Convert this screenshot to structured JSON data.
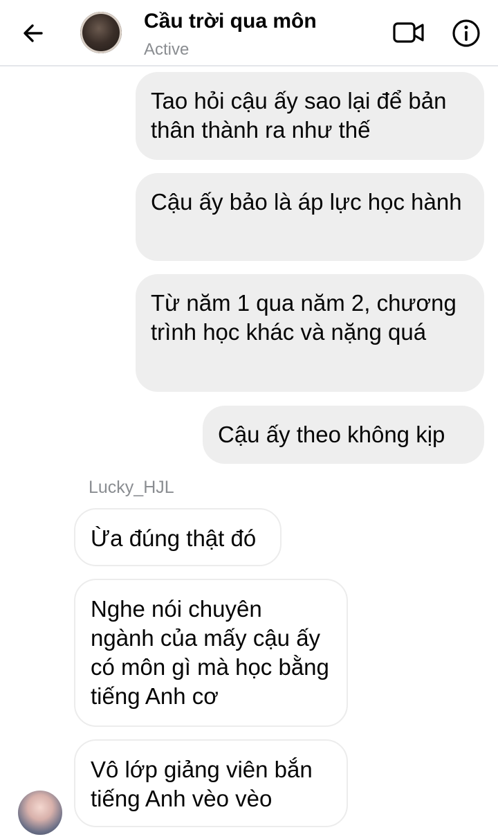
{
  "header": {
    "back_icon": "arrow-left-icon",
    "title": "Cầu trời qua môn",
    "status": "Active",
    "video_icon": "video-camera-icon",
    "info_icon": "info-icon"
  },
  "messages": [
    {
      "direction": "sent",
      "text": "Tao hỏi cậu ấy sao lại để bản thân thành ra như thế"
    },
    {
      "direction": "sent",
      "text": "Cậu ấy bảo là áp lực học hành"
    },
    {
      "direction": "sent",
      "text": "Từ năm 1 qua năm 2, chương trình học khác và nặng quá"
    },
    {
      "direction": "sent",
      "text": "Cậu ấy theo không kịp"
    },
    {
      "direction": "received",
      "text": "Ừa đúng thật đó"
    },
    {
      "direction": "received",
      "text": "Nghe nói chuyên ngành của mấy cậu ấy có môn gì mà học bằng tiếng Anh cơ"
    },
    {
      "direction": "received",
      "text": "Vô lớp giảng viên bắn tiếng Anh vèo vèo"
    }
  ],
  "sender_name": "Lucky_HJL",
  "colors": {
    "sent_bubble": "#eeeeee",
    "received_border": "#ececec",
    "text": "#050505",
    "muted": "#8a8d91"
  }
}
